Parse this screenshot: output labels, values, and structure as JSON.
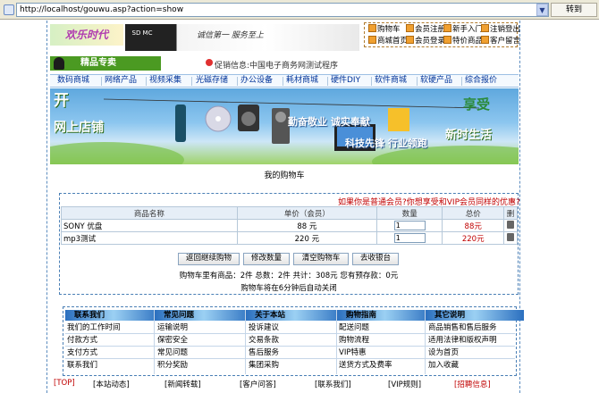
{
  "browser": {
    "url": "http://localhost/gouwu.asp?action=show",
    "go_label": "转到",
    "go_arrow": "➜"
  },
  "header": {
    "logo_text": "欢乐时代",
    "slogan": "诚信第一  服务至上",
    "card_label": "SD MC",
    "top_nav": [
      "购物车",
      "会员注册",
      "新手入门",
      "注销登出",
      "商城首页",
      "会员登录",
      "特价商品",
      "客户留言"
    ],
    "promo_label": "精品专卖",
    "notice": "促销信息:中国电子商务网测试程序"
  },
  "categories": [
    "数码商城",
    "网络产品",
    "视频采集",
    "光磁存储",
    "办公设备",
    "耗材商城",
    "硬件DIY",
    "软件商城",
    "软硬产品",
    "综合报价"
  ],
  "hero": {
    "left_line1": "开",
    "left_line2": "网上店铺",
    "middle_line1": "勤奋敬业  诚实奉献",
    "middle_line2": "科技先锋  行业领跑",
    "right_line1": "享受",
    "right_line2": "新时生活"
  },
  "cart": {
    "title": "我的购物车",
    "vip_question": "如果你是普通会员?你想享受和VIP会员同样的优惠?",
    "headers": [
      "商品名称",
      "单价（会员）",
      "数量",
      "总价",
      "删"
    ],
    "rows": [
      {
        "name": "SONY 优盘",
        "price": "88 元",
        "qty": "1",
        "total": "88元"
      },
      {
        "name": "mp3测试",
        "price": "220 元",
        "qty": "1",
        "total": "220元"
      }
    ],
    "buttons": [
      "返回继续购物",
      "修改数量",
      "清空购物车",
      "去收银台"
    ],
    "summary": "购物车里有商品：2件   总数：2件   共计：308元   您有预存款：0元",
    "autoclose": "购物车将在6分钟后自动关闭"
  },
  "footer": {
    "columns": [
      {
        "title": "联系我们",
        "items": [
          "我们的工作时间",
          "付款方式",
          "支付方式",
          "联系我们"
        ]
      },
      {
        "title": "常见问题",
        "items": [
          "运输说明",
          "保密安全",
          "常见问题",
          "积分奖励"
        ]
      },
      {
        "title": "关于本站",
        "items": [
          "投诉建议",
          "交易条款",
          "售后服务",
          "集团采购"
        ]
      },
      {
        "title": "购物指南",
        "items": [
          "配送问题",
          "购物流程",
          "VIP特惠",
          "送货方式及费率"
        ]
      },
      {
        "title": "其它说明",
        "items": [
          "商品销售和售后服务",
          "适用法律和版权声明",
          "设为首页",
          "加入收藏"
        ]
      }
    ],
    "bottom_links": [
      "[TOP]",
      "[本站动态]",
      "[新闻转载]",
      "[客户问答]",
      "[联系我们]",
      "[VIP规则]",
      "[招聘信息]"
    ]
  },
  "colors": {
    "accent_red": "#c00000",
    "link_blue": "#003399",
    "promo_green": "#4b9a22"
  }
}
